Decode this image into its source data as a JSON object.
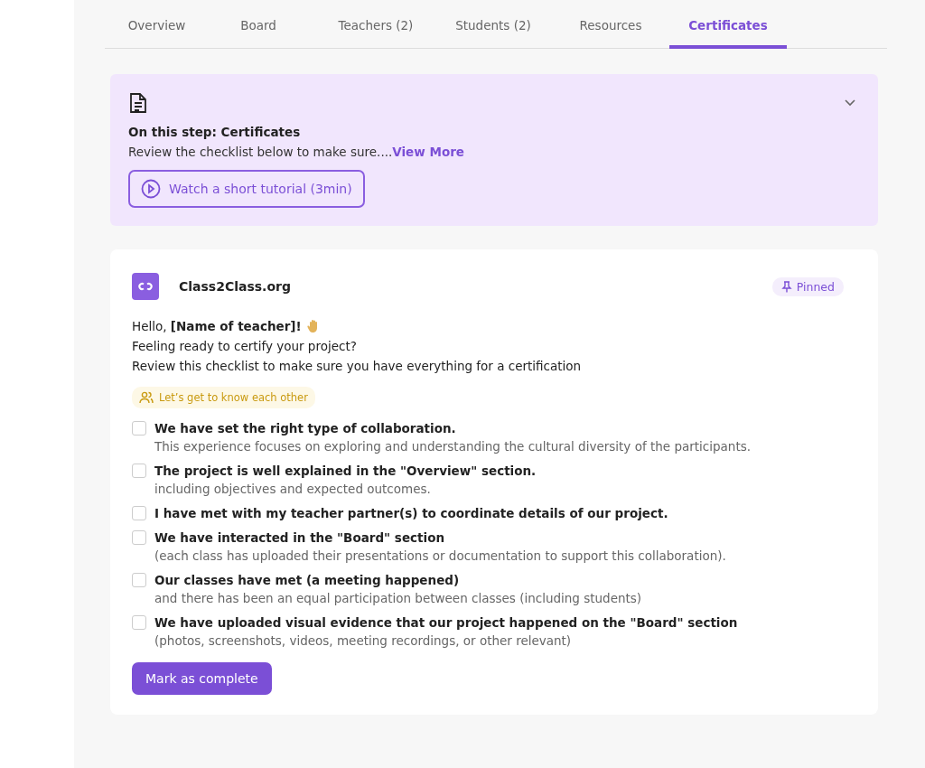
{
  "tabs": [
    {
      "label": "Overview",
      "selected": false
    },
    {
      "label": "Board",
      "selected": false
    },
    {
      "label": "Teachers (2)",
      "selected": false
    },
    {
      "label": "Students (2)",
      "selected": false
    },
    {
      "label": "Resources",
      "selected": false
    },
    {
      "label": "Certificates",
      "selected": true
    }
  ],
  "step_panel": {
    "expanded": false,
    "title": "On this step: Certificates",
    "description": "Review the checklist below to make sure....",
    "link": "View More",
    "tutorial_button": "Watch a short tutorial (3min)"
  },
  "post": {
    "author": "Class2Class.org",
    "badge": "Pinned",
    "greeting": "Hello, **[Name of teacher]!**",
    "lines": [
      "Feeling ready to certify your project?",
      "Review this checklist to make sure you have everything for a certification"
    ],
    "tag": "Let’s get to know each other",
    "checklist": [
      {
        "title": "We have set the right type of collaboration.",
        "detail": "This experience focuses on exploring and understanding the cultural diversity of the participants.",
        "checked": false
      },
      {
        "title": "The project is well explained in the \"Overview\" section.",
        "detail": "including objectives and expected outcomes.",
        "checked": false
      },
      {
        "title": "I have met with my teacher partner(s) to coordinate details of our project.",
        "checked": false
      },
      {
        "title": "We have interacted in the \"Board\" section",
        "detail": "(each class has uploaded their presentations or documentation to support this collaboration).",
        "checked": false
      },
      {
        "title": "Our classes have met (a meeting happened)",
        "detail": "and there has been an equal participation between classes (including students)",
        "checked": false
      },
      {
        "title": "We have uploaded visual evidence that our project happened on the \"Board\" section",
        "detail": "(photos, screenshots, videos, meeting recordings, or other relevant)",
        "checked": false
      }
    ],
    "button": "Mark as complete"
  }
}
